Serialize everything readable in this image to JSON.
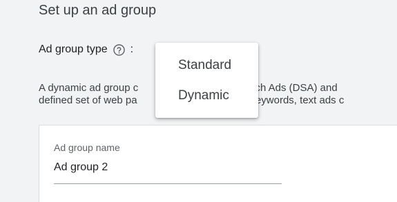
{
  "page": {
    "title": "Set up an ad group"
  },
  "ad_group_type": {
    "label": "Ad group type",
    "colon": ":",
    "help_icon": "help-circle-icon"
  },
  "description": {
    "line1": "A dynamic ad group c",
    "line1_rest": "mic Search Ads (DSA) and",
    "line2": "defined set of web pa",
    "line2_rest": "r own keywords, text ads c"
  },
  "ad_group_name": {
    "label": "Ad group name",
    "value": "Ad group 2"
  },
  "type_menu": {
    "options": [
      "Standard",
      "Dynamic"
    ]
  },
  "colors": {
    "background": "#f1f3f4",
    "card": "#ffffff",
    "text_primary": "#202124",
    "text_secondary": "#5f6368"
  }
}
